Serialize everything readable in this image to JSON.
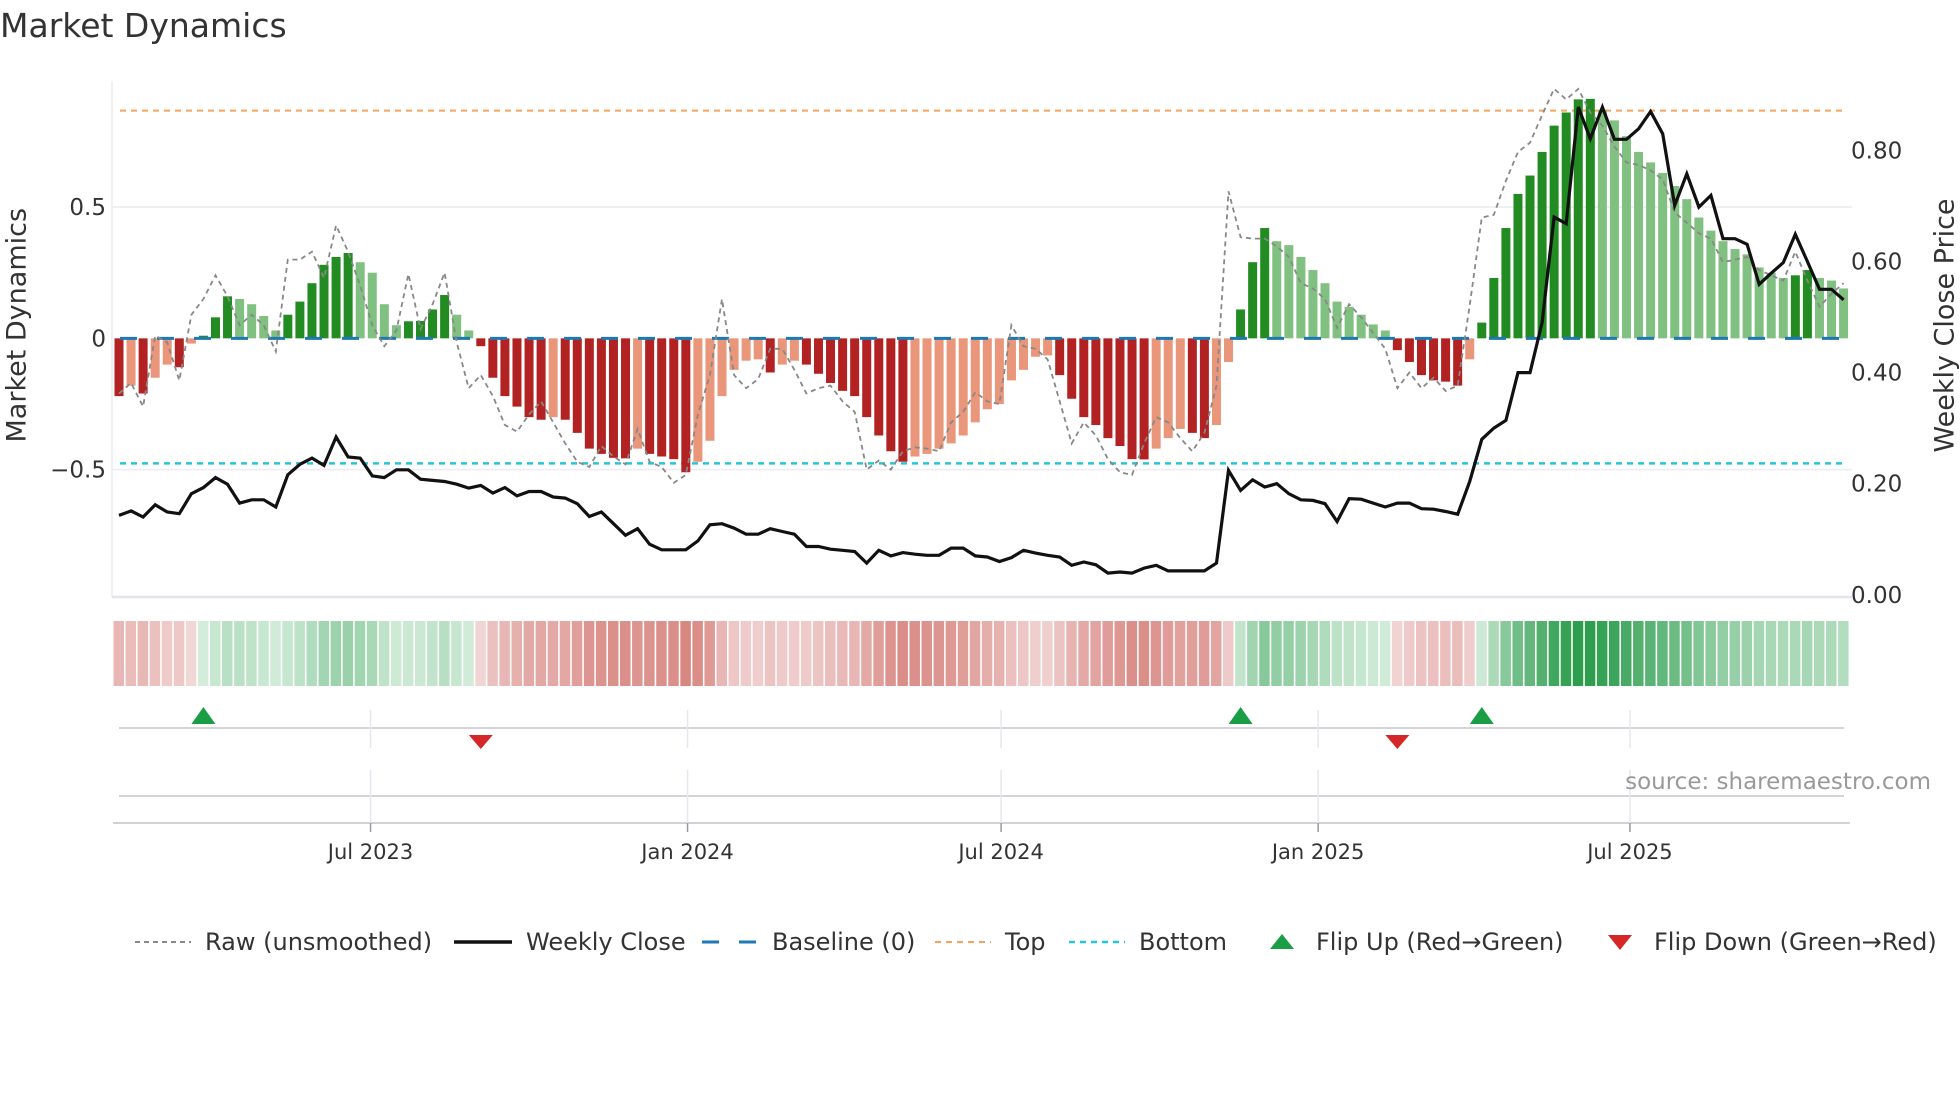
{
  "chart_data": {
    "type": "bar",
    "title": "Market Dynamics",
    "ylabel": "Market Dynamics",
    "ylabel_right": "Weekly Close Price",
    "x_start_date": "2023-02-05",
    "x_interval_days": 7,
    "ylim": [
      -0.985,
      0.98
    ],
    "ylim_right": [
      -0.004,
      0.925
    ],
    "grid": true,
    "y_ticks": [
      {
        "value": 0.5,
        "label": "0.5"
      },
      {
        "value": 0,
        "label": "0"
      },
      {
        "value": -0.5,
        "label": "−0.5"
      }
    ],
    "y_ticks_right": [
      {
        "value": 0.8,
        "label": "0.80"
      },
      {
        "value": 0.6,
        "label": "0.60"
      },
      {
        "value": 0.4,
        "label": "0.40"
      },
      {
        "value": 0.2,
        "label": "0.20"
      },
      {
        "value": 0.0,
        "label": "0.00"
      }
    ],
    "x_ticks": [
      {
        "date": "2023-07-01",
        "label": "Jul 2023"
      },
      {
        "date": "2024-01-01",
        "label": "Jan 2024"
      },
      {
        "date": "2024-07-01",
        "label": "Jul 2024"
      },
      {
        "date": "2025-01-01",
        "label": "Jan 2025"
      },
      {
        "date": "2025-07-01",
        "label": "Jul 2025"
      }
    ],
    "reference_lines": {
      "baseline": 0,
      "top": 0.867,
      "bottom": -0.476
    },
    "series": [
      {
        "name": "Market Dynamics",
        "type": "bar",
        "values": [
          -0.22,
          -0.18,
          -0.21,
          -0.15,
          -0.1,
          -0.11,
          -0.02,
          0.01,
          0.08,
          0.16,
          0.15,
          0.13,
          0.085,
          0.03,
          0.09,
          0.14,
          0.21,
          0.28,
          0.31,
          0.325,
          0.29,
          0.25,
          0.13,
          0.05,
          0.065,
          0.066,
          0.11,
          0.165,
          0.09,
          0.03,
          -0.03,
          -0.15,
          -0.22,
          -0.26,
          -0.3,
          -0.31,
          -0.3,
          -0.31,
          -0.36,
          -0.42,
          -0.44,
          -0.455,
          -0.457,
          -0.42,
          -0.44,
          -0.45,
          -0.46,
          -0.51,
          -0.47,
          -0.39,
          -0.22,
          -0.12,
          -0.085,
          -0.08,
          -0.13,
          -0.1,
          -0.085,
          -0.1,
          -0.135,
          -0.17,
          -0.2,
          -0.22,
          -0.3,
          -0.37,
          -0.43,
          -0.47,
          -0.45,
          -0.44,
          -0.42,
          -0.4,
          -0.37,
          -0.32,
          -0.27,
          -0.25,
          -0.16,
          -0.12,
          -0.07,
          -0.065,
          -0.14,
          -0.23,
          -0.3,
          -0.33,
          -0.38,
          -0.41,
          -0.46,
          -0.461,
          -0.42,
          -0.38,
          -0.345,
          -0.36,
          -0.38,
          -0.33,
          -0.09,
          0.11,
          0.29,
          0.42,
          0.37,
          0.355,
          0.31,
          0.26,
          0.21,
          0.14,
          0.12,
          0.09,
          0.053,
          0.03,
          -0.045,
          -0.09,
          -0.14,
          -0.16,
          -0.165,
          -0.18,
          -0.08,
          0.06,
          0.23,
          0.42,
          0.55,
          0.62,
          0.71,
          0.81,
          0.86,
          0.91,
          0.912,
          0.87,
          0.83,
          0.77,
          0.71,
          0.67,
          0.63,
          0.58,
          0.53,
          0.46,
          0.41,
          0.37,
          0.34,
          0.32,
          0.27,
          0.25,
          0.23,
          0.24,
          0.26,
          0.23,
          0.22,
          0.19
        ]
      },
      {
        "name": "Raw (unsmoothed)",
        "type": "line",
        "values": [
          -0.21,
          -0.17,
          -0.26,
          0.01,
          -0.015,
          -0.16,
          0.09,
          0.15,
          0.24,
          0.16,
          0.05,
          0.09,
          0.05,
          -0.05,
          0.3,
          0.3,
          0.33,
          0.23,
          0.43,
          0.33,
          0.2,
          0.05,
          -0.03,
          0.03,
          0.245,
          0.035,
          0.13,
          0.25,
          -0.015,
          -0.19,
          -0.14,
          -0.22,
          -0.33,
          -0.355,
          -0.29,
          -0.24,
          -0.32,
          -0.4,
          -0.47,
          -0.49,
          -0.41,
          -0.45,
          -0.48,
          -0.345,
          -0.47,
          -0.49,
          -0.55,
          -0.52,
          -0.29,
          -0.14,
          0.15,
          -0.14,
          -0.19,
          -0.155,
          -0.04,
          -0.04,
          -0.12,
          -0.21,
          -0.19,
          -0.18,
          -0.24,
          -0.28,
          -0.5,
          -0.465,
          -0.5,
          -0.43,
          -0.415,
          -0.42,
          -0.43,
          -0.32,
          -0.28,
          -0.205,
          -0.24,
          -0.25,
          0.05,
          -0.03,
          -0.04,
          -0.08,
          -0.24,
          -0.4,
          -0.32,
          -0.37,
          -0.46,
          -0.51,
          -0.52,
          -0.4,
          -0.3,
          -0.32,
          -0.38,
          -0.43,
          -0.36,
          -0.18,
          0.56,
          0.385,
          0.38,
          0.38,
          0.35,
          0.31,
          0.21,
          0.19,
          0.15,
          0.04,
          0.13,
          0.08,
          0.02,
          -0.04,
          -0.19,
          -0.13,
          -0.19,
          -0.15,
          -0.2,
          -0.18,
          0.125,
          0.46,
          0.47,
          0.6,
          0.71,
          0.745,
          0.85,
          0.95,
          0.91,
          0.95,
          0.86,
          0.81,
          0.73,
          0.67,
          0.66,
          0.64,
          0.605,
          0.48,
          0.44,
          0.4,
          0.38,
          0.29,
          0.3,
          0.31,
          0.26,
          0.24,
          0.22,
          0.33,
          0.22,
          0.12,
          0.17,
          0.21
        ]
      },
      {
        "name": "Weekly Close",
        "type": "line",
        "axis": "right",
        "values": [
          0.143,
          0.151,
          0.14,
          0.162,
          0.149,
          0.146,
          0.182,
          0.193,
          0.211,
          0.199,
          0.165,
          0.171,
          0.171,
          0.158,
          0.216,
          0.235,
          0.246,
          0.233,
          0.284,
          0.248,
          0.246,
          0.214,
          0.211,
          0.225,
          0.225,
          0.208,
          0.206,
          0.204,
          0.199,
          0.192,
          0.197,
          0.183,
          0.193,
          0.178,
          0.186,
          0.186,
          0.176,
          0.174,
          0.164,
          0.141,
          0.149,
          0.128,
          0.107,
          0.119,
          0.091,
          0.081,
          0.081,
          0.081,
          0.097,
          0.126,
          0.128,
          0.12,
          0.109,
          0.109,
          0.119,
          0.114,
          0.109,
          0.087,
          0.087,
          0.082,
          0.08,
          0.078,
          0.057,
          0.08,
          0.07,
          0.076,
          0.073,
          0.071,
          0.071,
          0.084,
          0.084,
          0.07,
          0.068,
          0.06,
          0.067,
          0.08,
          0.075,
          0.071,
          0.068,
          0.053,
          0.059,
          0.054,
          0.039,
          0.041,
          0.039,
          0.048,
          0.053,
          0.043,
          0.043,
          0.043,
          0.043,
          0.057,
          0.224,
          0.188,
          0.207,
          0.194,
          0.2,
          0.182,
          0.171,
          0.17,
          0.164,
          0.132,
          0.173,
          0.172,
          0.165,
          0.158,
          0.165,
          0.165,
          0.155,
          0.154,
          0.15,
          0.145,
          0.204,
          0.28,
          0.3,
          0.314,
          0.4,
          0.4,
          0.49,
          0.68,
          0.668,
          0.878,
          0.821,
          0.878,
          0.82,
          0.82,
          0.839,
          0.87,
          0.83,
          0.701,
          0.758,
          0.698,
          0.719,
          0.641,
          0.641,
          0.631,
          0.559,
          0.579,
          0.598,
          0.649,
          0.6,
          0.55,
          0.55,
          0.531
        ]
      }
    ],
    "flips": [
      {
        "week": 8,
        "direction": "up"
      },
      {
        "week": 31,
        "direction": "down"
      },
      {
        "week": 94,
        "direction": "up"
      },
      {
        "week": 107,
        "direction": "down"
      },
      {
        "week": 114,
        "direction": "up"
      }
    ],
    "legend_position": "bottom",
    "legend": [
      {
        "key": "raw",
        "label": "Raw (unsmoothed)"
      },
      {
        "key": "close",
        "label": "Weekly Close"
      },
      {
        "key": "baseline",
        "label": "Baseline (0)"
      },
      {
        "key": "top",
        "label": "Top"
      },
      {
        "key": "bottom",
        "label": "Bottom"
      },
      {
        "key": "flip_up",
        "label": "Flip Up (Red→Green)"
      },
      {
        "key": "flip_down",
        "label": "Flip Down (Green→Red)"
      }
    ],
    "source": "source: sharemaestro.com",
    "colors": {
      "bull_strong": "#228b22",
      "bull_weak": "#80c080",
      "bear_strong": "#b22222",
      "bear_weak": "#e9967a",
      "baseline": "#1f77b4",
      "top": "#f4a460",
      "bottom": "#26c6da",
      "raw": "#888888",
      "close": "#111111",
      "flip_up": "#1a9e45",
      "flip_down": "#d62728"
    }
  }
}
